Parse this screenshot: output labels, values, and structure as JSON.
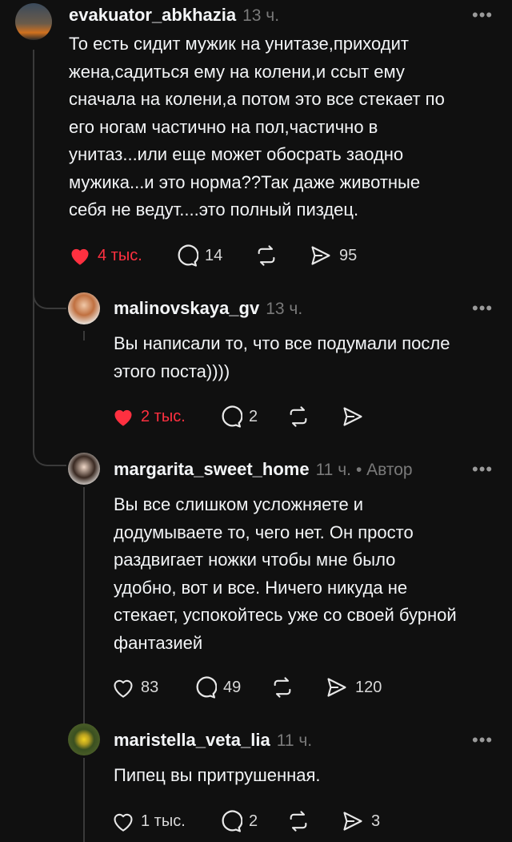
{
  "comments": [
    {
      "username": "evakuator_abkhazia",
      "time": "13 ч.",
      "author_tag": "",
      "text": [
        "То есть сидит мужик на унитазе,приходит",
        "жена,садиться ему на колени,и ссыт ему",
        "сначала на колени,а потом это все стекает по",
        "его ногам частично на пол,частично в",
        "унитаз...или еще может обосрать заодно",
        "мужика...и это норма??Так даже животные",
        "себя не ведут....это полный пиздец."
      ],
      "likes": "4 тыс.",
      "liked": true,
      "replies": "14",
      "reposts": "",
      "shares": "95",
      "avatar_color": "#6a5b4a"
    },
    {
      "username": "malinovskaya_gv",
      "time": "13 ч.",
      "author_tag": "",
      "text": [
        "Вы написали то, что все подумали после",
        "этого поста))))"
      ],
      "likes": "2 тыс.",
      "liked": true,
      "replies": "2",
      "reposts": "",
      "shares": "",
      "avatar_color": "#b8b0a8"
    },
    {
      "username": "margarita_sweet_home",
      "time": "11 ч.",
      "author_tag": "• Автор",
      "text": [
        "Вы все слишком усложняете и",
        "додумываете то, чего нет. Он просто",
        "раздвигает ножки чтобы мне было",
        "удобно, вот и все. Ничего никуда не",
        "стекает, успокойтесь уже со своей бурной",
        "фантазией"
      ],
      "likes": "83",
      "liked": false,
      "replies": "49",
      "reposts": "",
      "shares": "120",
      "avatar_color": "#c9c1bb"
    },
    {
      "username": "maristella_veta_lia",
      "time": "11 ч.",
      "author_tag": "",
      "text": [
        "Пипец вы притрушенная."
      ],
      "likes": "1 тыс.",
      "liked": false,
      "replies": "2",
      "reposts": "",
      "shares": "3",
      "avatar_color": "#4a5a2a"
    }
  ],
  "more_label": "•••",
  "colors": {
    "background": "#101010",
    "like_active": "#ff3040",
    "muted": "#7a7a7a",
    "thread_line": "#3a3a3a"
  },
  "icons": [
    "heart-icon",
    "comment-icon",
    "repost-icon",
    "share-icon",
    "more-icon"
  ]
}
